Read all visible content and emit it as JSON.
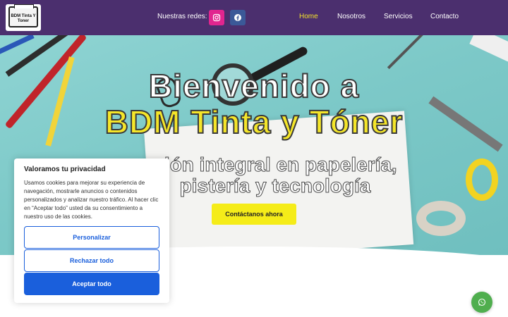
{
  "header": {
    "logo_text": "BDM Tinta Y Toner",
    "socials_label": "Nuestras redes:",
    "socials": [
      {
        "name": "instagram",
        "icon": "instagram-icon",
        "color": "#e1258f"
      },
      {
        "name": "facebook",
        "icon": "facebook-icon",
        "color": "#3b5998"
      }
    ],
    "nav": [
      {
        "label": "Home",
        "active": true
      },
      {
        "label": "Nosotros",
        "active": false
      },
      {
        "label": "Servicios",
        "active": false
      },
      {
        "label": "Contacto",
        "active": false
      }
    ],
    "background": "#4b2f6e",
    "active_color": "#f2e12b"
  },
  "hero": {
    "title_line1": "Bienvenido a",
    "title_line2": "BDM Tinta y Tóner",
    "subtitle_line1": "ción integral en papelería,",
    "subtitle_line2": "pistería y tecnología",
    "cta_label": "Contáctanos ahora",
    "accent": "#f5e629"
  },
  "cookie": {
    "title": "Valoramos tu privacidad",
    "body": "Usamos cookies para mejorar su experiencia de navegación, mostrarle anuncios o contenidos personalizados y analizar nuestro tráfico. Al hacer clic en “Aceptar todo” usted da su consentimiento a nuestro uso de las cookies.",
    "btn_customize": "Personalizar",
    "btn_reject": "Rechazar todo",
    "btn_accept": "Aceptar todo",
    "primary_color": "#1a5fdc"
  },
  "chat": {
    "icon": "whatsapp-icon",
    "color": "#4fae4e"
  }
}
